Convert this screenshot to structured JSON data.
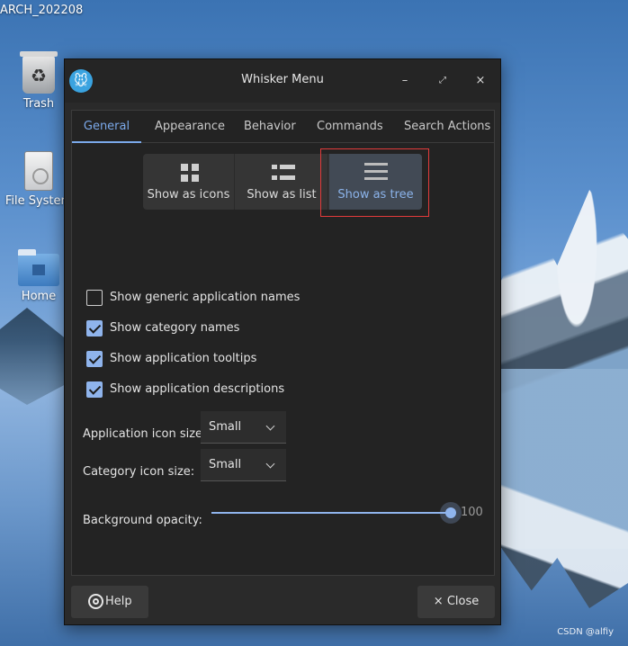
{
  "desktop": {
    "top_label": "ARCH_202208",
    "icons": [
      {
        "label": "Trash",
        "icon": "recycle-icon"
      },
      {
        "label": "File System",
        "icon": "drive-icon"
      },
      {
        "label": "Home",
        "icon": "folder-home-icon"
      }
    ],
    "watermark": "CSDN @alfiy"
  },
  "window": {
    "title": "Whisker Menu",
    "minimize_symbol": "–",
    "maximize_symbol": "⤢",
    "close_symbol": "×"
  },
  "tabs": [
    {
      "label": "General",
      "active": true
    },
    {
      "label": "Appearance",
      "active": false
    },
    {
      "label": "Behavior",
      "active": false
    },
    {
      "label": "Commands",
      "active": false
    },
    {
      "label": "Search Actions",
      "active": false
    }
  ],
  "view_modes": [
    {
      "label": "Show as icons",
      "icon": "grid-icon",
      "selected": false
    },
    {
      "label": "Show as list",
      "icon": "list-icon",
      "selected": false
    },
    {
      "label": "Show as tree",
      "icon": "tree-icon",
      "selected": true
    }
  ],
  "checkboxes": [
    {
      "label": "Show generic application names",
      "checked": false
    },
    {
      "label": "Show category names",
      "checked": true
    },
    {
      "label": "Show application tooltips",
      "checked": true
    },
    {
      "label": "Show application descriptions",
      "checked": true
    }
  ],
  "app_icon_size": {
    "label": "Application icon size:",
    "value": "Small"
  },
  "category_icon_size": {
    "label": "Category icon size:",
    "value": "Small"
  },
  "opacity": {
    "label": "Background opacity:",
    "value": 100,
    "display": "100"
  },
  "footer": {
    "help_label": "Help",
    "close_label": "Close",
    "close_symbol": "×"
  },
  "colors": {
    "accent": "#8fb4ec",
    "highlight_box": "#e33b3b"
  }
}
